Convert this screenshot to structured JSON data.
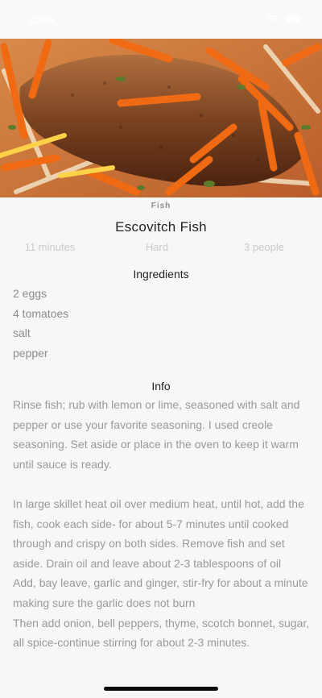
{
  "status_bar": {
    "time": "2:06",
    "icons": [
      "wifi-icon",
      "battery-icon"
    ],
    "text_color": "#ffffff"
  },
  "hero": {
    "image": "fried-fish-with-carrots-photo"
  },
  "recipe": {
    "category": "Fish",
    "title": "Escovitch Fish",
    "time": "11 minutes",
    "difficulty": "Hard",
    "servings": "3 people"
  },
  "sections": {
    "ingredients_title": "Ingredients",
    "info_title": "Info"
  },
  "ingredients": [
    "2 eggs",
    "4 tomatoes",
    "salt",
    "pepper"
  ],
  "info": "Rinse fish; rub with lemon or lime, seasoned with salt and pepper or use your favorite seasoning. I used creole seasoning. Set aside or place in the oven to keep it warm until sauce is ready.\n\nIn large skillet heat oil over medium heat, until hot, add the fish, cook each side- for about 5-7 minutes until cooked through and crispy on both sides. Remove fish and set aside. Drain oil and leave about 2-3 tablespoons of oil\nAdd, bay leave, garlic and ginger, stir-fry for about a minute making sure the garlic does not burn\nThen add onion, bell peppers, thyme, scotch bonnet, sugar, all spice-continue stirring for about 2-3 minutes.",
  "colors": {
    "background": "#f7f7f7",
    "title": "#222222",
    "secondary_text": "#8c8c8c",
    "meta_text": "#c9c9c9"
  }
}
